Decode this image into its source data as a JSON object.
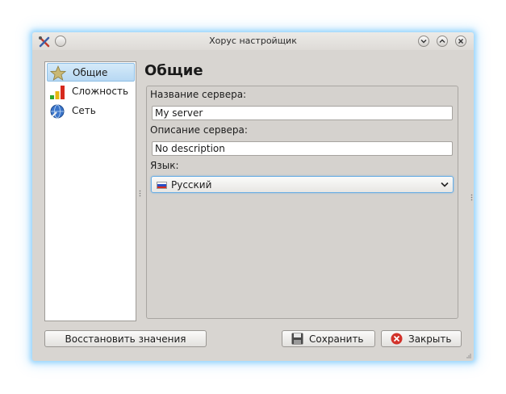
{
  "window": {
    "title": "Хорус настройщик",
    "accent_color": "#7fc8f8"
  },
  "sidebar": {
    "items": [
      {
        "label": "Общие",
        "icon": "star-icon",
        "selected": true
      },
      {
        "label": "Сложность",
        "icon": "difficulty-bars-icon",
        "selected": false
      },
      {
        "label": "Сеть",
        "icon": "network-globe-icon",
        "selected": false
      }
    ]
  },
  "main": {
    "title": "Общие",
    "server_name": {
      "label": "Название сервера:",
      "value": "My server"
    },
    "server_description": {
      "label": "Описание сервера:",
      "value": "No description"
    },
    "language": {
      "label": "Язык:",
      "value": "Русский",
      "icon": "russia-flag-icon"
    }
  },
  "buttons": {
    "restore": "Восстановить значения",
    "save": "Сохранить",
    "close": "Закрыть"
  }
}
